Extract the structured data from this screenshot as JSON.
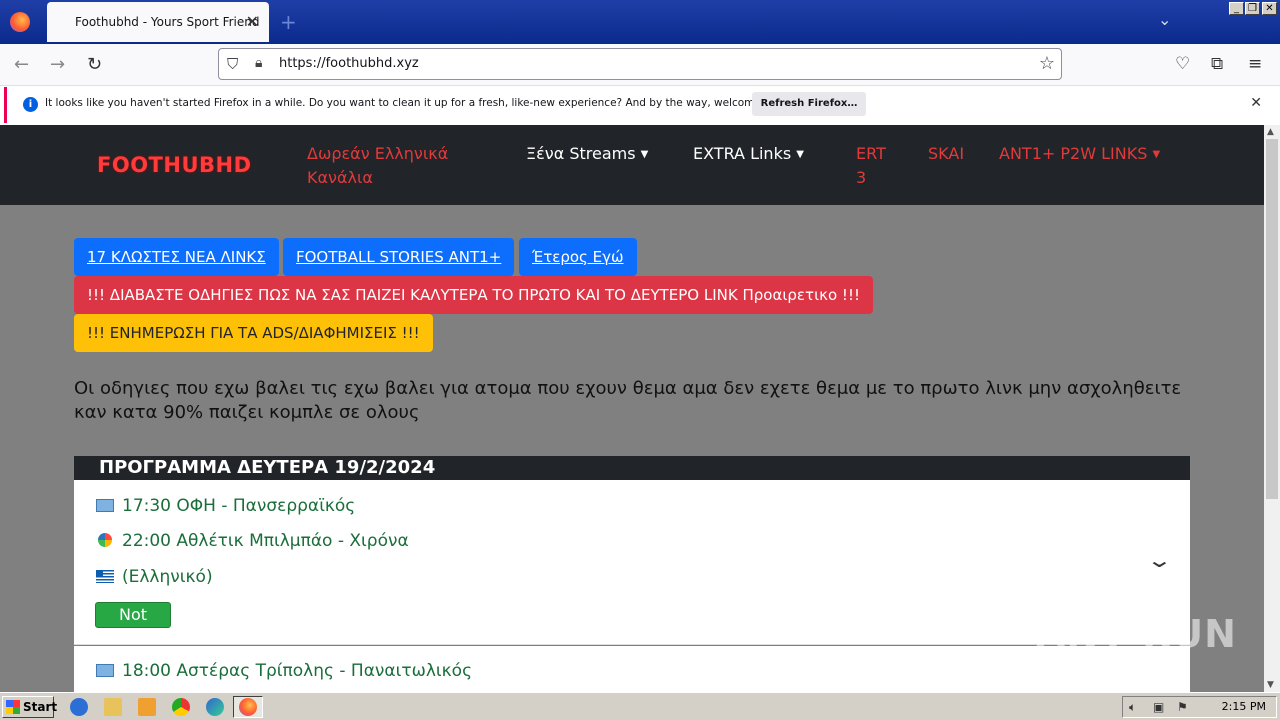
{
  "browser": {
    "tab_title": "Foothubhd - Yours Sport Friend",
    "url": "https://foothubhd.xyz",
    "notification_message": "It looks like you haven't started Firefox in a while. Do you want to clean it up for a fresh, like-new experience? And by the way, welcome back!",
    "refresh_button": "Refresh Firefox…"
  },
  "site": {
    "brand": "FOOTHUBHD",
    "nav": {
      "free_greek": "Δωρεάν Ελληνικά",
      "free_greek_2": "Κανάλια",
      "foreign_streams": "Ξένα Streams",
      "extra_links": "EXTRA Links",
      "ert": "ERT",
      "ert_num": "3",
      "skai": "SKAI",
      "ant1": "ANT1+ P2W LINKS"
    },
    "pills": {
      "klostes": "17 ΚΛΩΣΤΕΣ ΝΕΑ ΛΙΝΚΣ",
      "football_stories": "FOOTBALL STORIES ANT1+",
      "eteros": "Έτερος Εγώ",
      "instructions": "!!! ΔΙΑΒΑΣΤΕ ΟΔΗΓΙΕΣ ΠΩΣ ΝΑ ΣΑΣ ΠΑΙΖΕΙ ΚΑΛΥΤΕΡΑ ΤΟ ΠΡΩΤΟ ΚΑΙ ΤΟ ΔΕΥΤΕΡΟ LINK Προαιρετικο !!!",
      "ads": "!!! ΕΝΗΜΕΡΩΣΗ ΓΙΑ ΤΑ ADS/ΔΙΑΦΗΜΙΣΕΙΣ !!!"
    },
    "notice": "Οι οδηγιες που εχω βαλει τις εχω βαλει για ατομα που εχουν θεμα αμα δεν εχετε θεμα με το πρωτο λινκ μην ασχοληθειτε καν κατα 90% παιζει κομπλε σε ολους",
    "schedule_title": "ΠΡΟΓΡΑΜΜΑ ΔΕΥΤΕΡΑ 19/2/2024",
    "matches": [
      "17:30 ΟΦΗ - Πανσερραϊκός",
      "22:00 Αθλέτικ Μπιλμπάο - Χιρόνα",
      "(Ελληνικό)"
    ],
    "status_badge": "Not",
    "next_match": "18:00 Αστέρας Τρίπολης - Παναιτωλικός"
  },
  "watermark": "ANY RUN",
  "taskbar": {
    "start": "Start",
    "clock": "2:15 PM"
  },
  "icons": [
    "firefox-icon",
    "shield-icon",
    "lock-icon",
    "star-icon",
    "pocket-icon",
    "extensions-icon",
    "menu-icon",
    "info-icon",
    "close-icon",
    "chevron-down-icon",
    "greece-flag-icon",
    "superleague-icon",
    "laliga-icon"
  ]
}
